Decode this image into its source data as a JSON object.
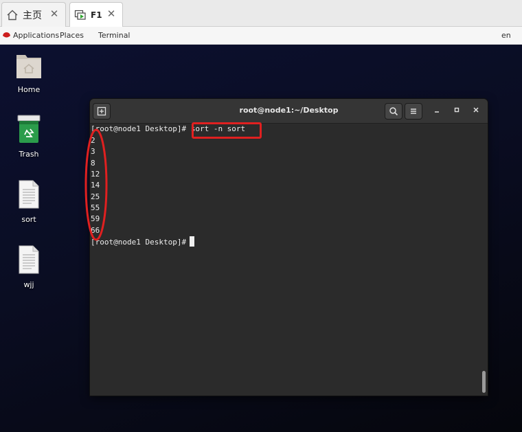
{
  "browser_tabs": [
    {
      "label": "主页",
      "icon": "home-icon",
      "active": false
    },
    {
      "label": "F1",
      "icon": "vm-console-icon",
      "active": true
    }
  ],
  "topbar": {
    "applications": "Applications",
    "places": "Places",
    "terminal": "Terminal",
    "language": "en"
  },
  "desktop_icons": [
    {
      "label": "Home",
      "icon": "home-folder-icon"
    },
    {
      "label": "Trash",
      "icon": "trash-icon"
    },
    {
      "label": "sort",
      "icon": "text-file-icon"
    },
    {
      "label": "wjj",
      "icon": "text-file-icon"
    }
  ],
  "terminal": {
    "title": "root@node1:~/Desktop",
    "prompt": "[root@node1 Desktop]#",
    "command": "sort -n sort",
    "output": [
      "2",
      "3",
      "8",
      "12",
      "14",
      "25",
      "55",
      "59",
      "66"
    ]
  },
  "colors": {
    "annotation": "#e02020",
    "terminal_bg": "#2b2b2b",
    "desktop_bg": "#0a0d22"
  }
}
